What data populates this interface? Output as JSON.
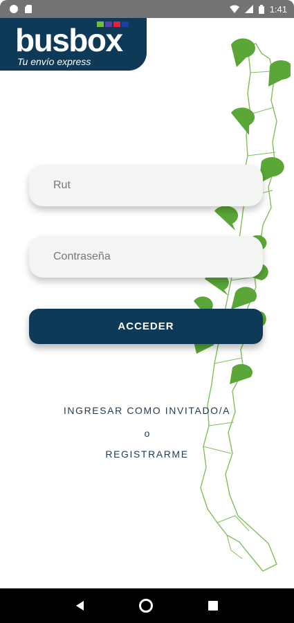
{
  "status_bar": {
    "time": "1:41"
  },
  "logo": {
    "name": "busbox",
    "tagline": "Tu envío express",
    "accent_colors": [
      "#6bbf3b",
      "#5b3fa6",
      "#e0223c",
      "#1c3f9e"
    ]
  },
  "login": {
    "rut_placeholder": "Rut",
    "password_placeholder": "Contraseña",
    "submit_label": "ACCEDER"
  },
  "links": {
    "guest_label": "INGRESAR COMO INVITADO/A",
    "separator": "o",
    "register_label": "REGISTRARME"
  },
  "theme": {
    "primary": "#0e3a57",
    "map_green": "#5aa637",
    "field_background": "#f3f5f3"
  },
  "map": {
    "pin_icon": "truck-location-pin-icon"
  }
}
